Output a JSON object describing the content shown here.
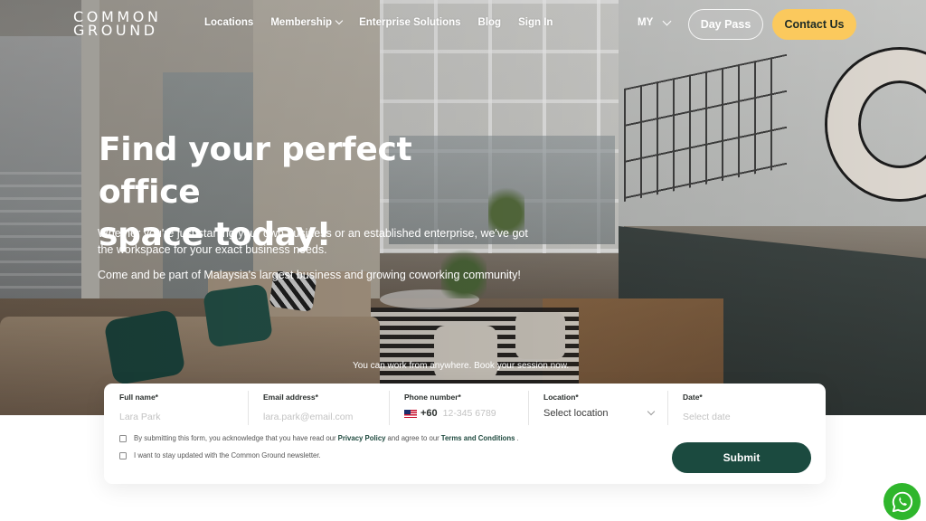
{
  "brand": {
    "logo_line1": "COMMON",
    "logo_line2": "GROUND"
  },
  "nav": {
    "links": [
      {
        "label": "Locations"
      },
      {
        "label": "Membership",
        "has_dropdown": true
      },
      {
        "label": "Enterprise Solutions"
      },
      {
        "label": "Blog"
      },
      {
        "label": "Sign In"
      }
    ],
    "country": "MY",
    "day_pass_label": "Day Pass",
    "contact_label": "Contact Us"
  },
  "hero": {
    "title_line1": "Find your perfect office",
    "title_line2": "space today!",
    "paragraph1": "Whether you're just starting your own business or an established enterprise, we've got the workspace for your exact business needs.",
    "paragraph2": "Come and be part of Malaysia's largest business and growing coworking community!",
    "cta_note": "You can work from anywhere. Book your session now."
  },
  "form": {
    "full_name": {
      "label": "Full name*",
      "placeholder": "Lara Park",
      "value": ""
    },
    "email": {
      "label": "Email address*",
      "placeholder": "lara.park@email.com",
      "value": ""
    },
    "phone": {
      "label": "Phone number*",
      "country_flag": "malaysia-flag-icon",
      "dial_code": "+60",
      "placeholder": "12-345 6789",
      "value": ""
    },
    "location": {
      "label": "Location*",
      "selected": "Select location"
    },
    "date": {
      "label": "Date*",
      "placeholder": "Select date",
      "value": ""
    },
    "consent_privacy": {
      "checked": false,
      "text_before": "By submitting this form, you acknowledge that you have read our",
      "privacy_link": "Privacy Policy",
      "text_middle": "and agree to our",
      "terms_link": "Terms and Conditions",
      "text_after": "."
    },
    "consent_newsletter": {
      "checked": false,
      "text": "I want to stay updated with the Common Ground newsletter."
    },
    "submit_label": "Submit"
  },
  "floating": {
    "whatsapp_icon": "whatsapp-icon"
  },
  "colors": {
    "accent_yellow": "#fbc95d",
    "brand_green": "#1b4a3f",
    "whatsapp_green": "#2fb62c"
  }
}
